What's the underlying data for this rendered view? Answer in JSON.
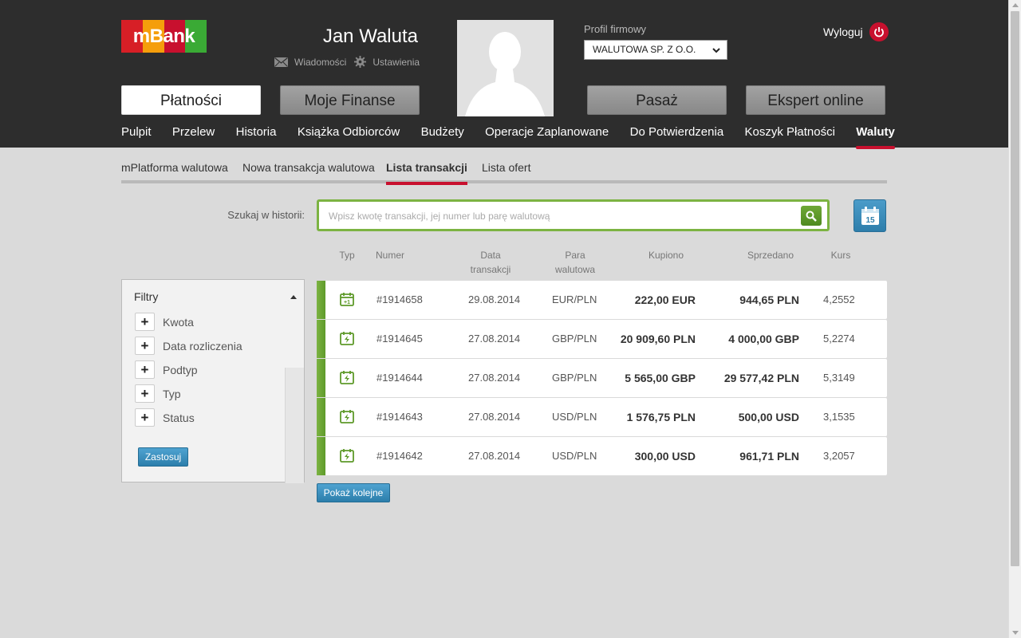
{
  "header": {
    "logo_text": "mBank",
    "logo_colors": [
      "#d71f26",
      "#f59e0b",
      "#c8102e",
      "#3aaa35"
    ],
    "user_name": "Jan Waluta",
    "messages_label": "Wiadomości",
    "settings_label": "Ustawienia",
    "profile_label": "Profil firmowy",
    "profile_value": "WALUTOWA SP. Z O.O.",
    "logout_label": "Wyloguj"
  },
  "big_tabs": [
    {
      "label": "Płatności",
      "active": true
    },
    {
      "label": "Moje Finanse",
      "active": false
    },
    {
      "label": "Pasaż",
      "active": false
    },
    {
      "label": "Ekspert online",
      "active": false
    }
  ],
  "main_nav": [
    {
      "label": "Pulpit"
    },
    {
      "label": "Przelew"
    },
    {
      "label": "Historia"
    },
    {
      "label": "Książka Odbiorców"
    },
    {
      "label": "Budżety"
    },
    {
      "label": "Operacje Zaplanowane"
    },
    {
      "label": "Do Potwierdzenia"
    },
    {
      "label": "Koszyk Płatności"
    },
    {
      "label": "Waluty",
      "active": true
    }
  ],
  "sub_nav": [
    {
      "label": "mPlatforma walutowa"
    },
    {
      "label": "Nowa transakcja walutowa"
    },
    {
      "label": "Lista transakcji",
      "active": true
    },
    {
      "label": "Lista ofert"
    }
  ],
  "search": {
    "label": "Szukaj w historii:",
    "placeholder": "Wpisz kwotę transakcji, jej numer lub parę walutową",
    "calendar_day": "15"
  },
  "columns": {
    "type": "Typ",
    "number": "Numer",
    "date": "Data transakcji",
    "pair": "Para walutowa",
    "bought": "Kupiono",
    "sold": "Sprzedano",
    "rate": "Kurs"
  },
  "filters": {
    "title": "Filtry",
    "items": [
      {
        "label": "Kwota"
      },
      {
        "label": "Data rozliczenia"
      },
      {
        "label": "Podtyp"
      },
      {
        "label": "Typ"
      },
      {
        "label": "Status"
      }
    ],
    "apply_label": "Zastosuj"
  },
  "transactions": [
    {
      "type_icon": "calendar-plus1-icon",
      "number": "#1914658",
      "date": "29.08.2014",
      "pair": "EUR/PLN",
      "bought": "222,00 EUR",
      "sold": "944,65 PLN",
      "rate": "4,2552"
    },
    {
      "type_icon": "calendar-bolt-icon",
      "number": "#1914645",
      "date": "27.08.2014",
      "pair": "GBP/PLN",
      "bought": "20 909,60 PLN",
      "sold": "4 000,00 GBP",
      "rate": "5,2274"
    },
    {
      "type_icon": "calendar-bolt-icon",
      "number": "#1914644",
      "date": "27.08.2014",
      "pair": "GBP/PLN",
      "bought": "5 565,00 GBP",
      "sold": "29 577,42 PLN",
      "rate": "5,3149"
    },
    {
      "type_icon": "calendar-bolt-icon",
      "number": "#1914643",
      "date": "27.08.2014",
      "pair": "USD/PLN",
      "bought": "1 576,75 PLN",
      "sold": "500,00 USD",
      "rate": "3,1535"
    },
    {
      "type_icon": "calendar-bolt-icon",
      "number": "#1914642",
      "date": "27.08.2014",
      "pair": "USD/PLN",
      "bought": "300,00 USD",
      "sold": "961,71 PLN",
      "rate": "3,2057"
    }
  ],
  "show_more_label": "Pokaż kolejne",
  "accent_color": "#c8102e",
  "green_color": "#7cb342"
}
